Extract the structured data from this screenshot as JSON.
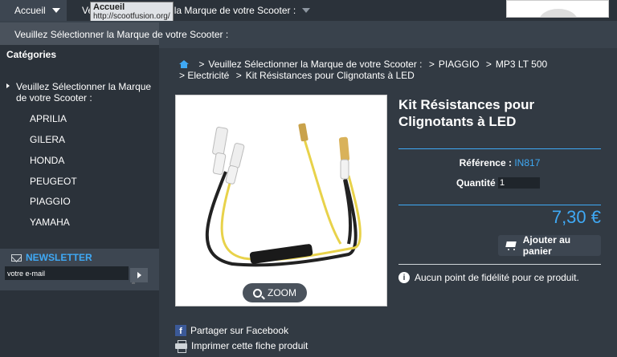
{
  "topnav": {
    "accueil": "Accueil",
    "marque": "Veuillez Sélectionner la Marque de votre Scooter :"
  },
  "tooltip": {
    "title": "Accueil",
    "url": "http://scootfusion.org/"
  },
  "dropdown": {
    "item": "Veuillez Sélectionner la Marque de votre Scooter :"
  },
  "sidebar": {
    "title": "Catégories",
    "header": "Veuillez Sélectionner la Marque de votre Scooter :",
    "items": [
      "APRILIA",
      "GILERA",
      "HONDA",
      "PEUGEOT",
      "PIAGGIO",
      "YAMAHA"
    ]
  },
  "newsletter": {
    "title": "NEWSLETTER",
    "placeholder": "votre e-mail",
    "small": "ok"
  },
  "breadcrumb": {
    "items": [
      "Veuillez Sélectionner la Marque de votre Scooter :",
      "PIAGGIO",
      "MP3 LT 500",
      "Electricité",
      "Kit Résistances pour Clignotants à LED"
    ]
  },
  "product": {
    "title": "Kit Résistances pour Clignotants à LED",
    "ref_label": "Référence :",
    "ref_value": "IN817",
    "qty_label": "Quantité :",
    "qty_value": "1",
    "price": "7,30 €",
    "cart_label": "Ajouter au panier",
    "fidelity": "Aucun point de fidélité pour ce produit.",
    "zoom": "ZOOM"
  },
  "share": {
    "facebook": "Partager sur Facebook",
    "print": "Imprimer cette fiche produit"
  },
  "colors": {
    "accent": "#3fa9f5",
    "background": "#323a43"
  }
}
